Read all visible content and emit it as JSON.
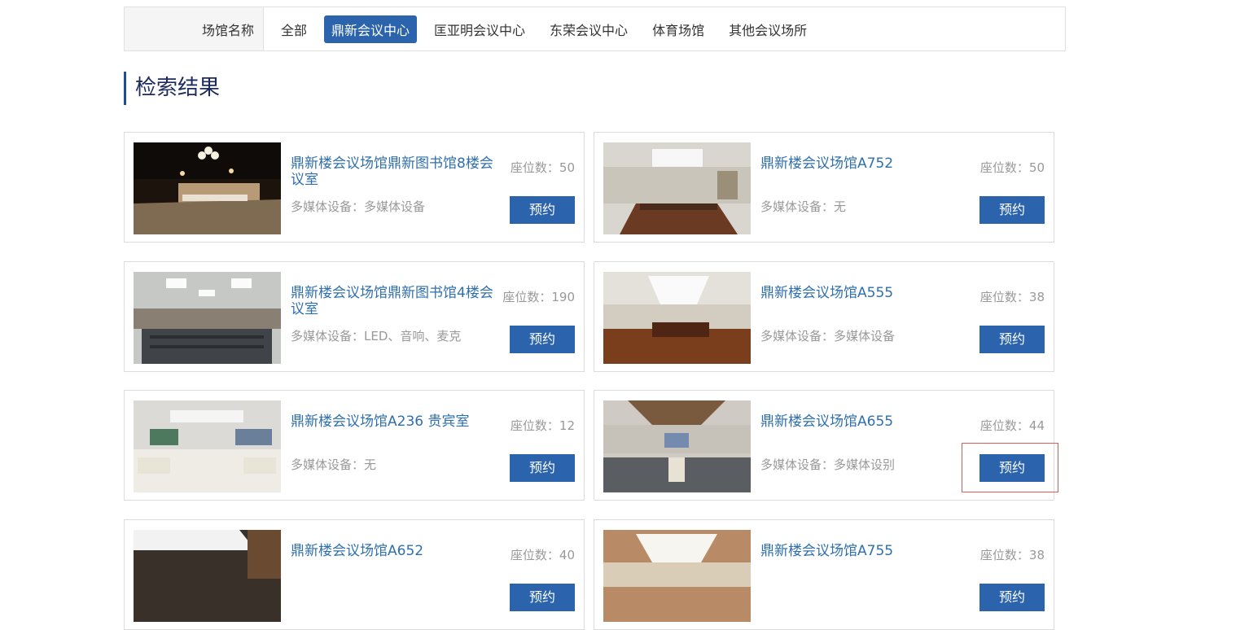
{
  "filter": {
    "label": "场馆名称",
    "options": [
      "全部",
      "鼎新会议中心",
      "匡亚明会议中心",
      "东荣会议中心",
      "体育场馆",
      "其他会议场所"
    ],
    "active_index": 1
  },
  "results": {
    "title": "检索结果",
    "book_label": "预约",
    "cards": [
      {
        "title": "鼎新楼会议场馆鼎新图书馆8楼会议室",
        "seats": "座位数：50",
        "equipment": "多媒体设备：多媒体设备"
      },
      {
        "title": "鼎新楼会议场馆A752",
        "seats": "座位数：50",
        "equipment": "多媒体设备：无"
      },
      {
        "title": "鼎新楼会议场馆鼎新图书馆4楼会议室",
        "seats": "座位数：190",
        "equipment": "多媒体设备：LED、音响、麦克"
      },
      {
        "title": "鼎新楼会议场馆A555",
        "seats": "座位数：38",
        "equipment": "多媒体设备：多媒体设备"
      },
      {
        "title": "鼎新楼会议场馆A236 贵宾室",
        "seats": "座位数：12",
        "equipment": "多媒体设备：无"
      },
      {
        "title": "鼎新楼会议场馆A655",
        "seats": "座位数：44",
        "equipment": "多媒体设备：多媒体设别"
      },
      {
        "title": "鼎新楼会议场馆A652",
        "seats": "座位数：40",
        "equipment": ""
      },
      {
        "title": "鼎新楼会议场馆A755",
        "seats": "座位数：38",
        "equipment": ""
      }
    ]
  },
  "colors": {
    "accent": "#2b64ac",
    "title_link": "#2f6fad",
    "muted": "#999999",
    "highlight": "#e05a5a"
  }
}
